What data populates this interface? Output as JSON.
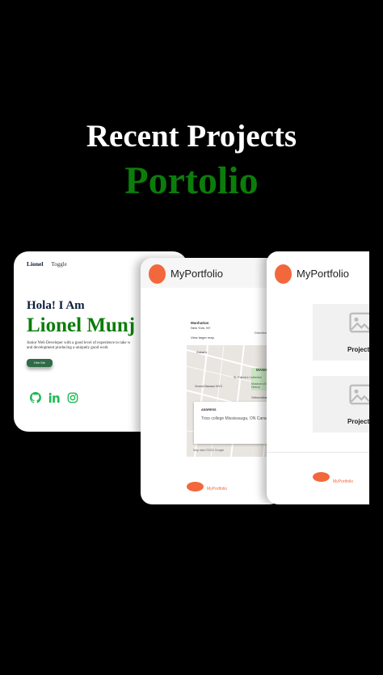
{
  "heading": {
    "title": "Recent Projects",
    "subtitle": "Portolio"
  },
  "card1": {
    "nav_name": "Lionel",
    "nav_toggle": "Toggle",
    "greeting": "Hola! I Am",
    "name": "Lionel Munj",
    "desc_line1": "Junior Web Developer with a good level of experience to take w",
    "desc_line2": "and development producing a uniquely good work",
    "button": "Hire Me",
    "social_icons": [
      "github-icon",
      "linkedin-icon",
      "instagram-icon"
    ],
    "accent": "#0b7d0b"
  },
  "card2": {
    "brand": "MyPortfolio",
    "map_place": "Manhattan",
    "map_region": "New York, NY",
    "map_link": "View larger map",
    "map_directions": "Directions",
    "map_labels": [
      "Zabar's",
      "Grand Bazaar NYC",
      "MANH",
      "St. Patrick's Cathedral",
      "Museum of Natural History",
      "Gelsomina"
    ],
    "address_title": "ADDRESS",
    "address_value": "Trios college Mississauga, ON Canada",
    "map_footer": "Map data ©2022 Google",
    "footer_brand": "MyPortfolio",
    "accent": "#f2683c"
  },
  "card3": {
    "brand": "MyPortfolio",
    "project1": "Project",
    "project2": "Project",
    "footer_brand": "MyPortfolio"
  }
}
